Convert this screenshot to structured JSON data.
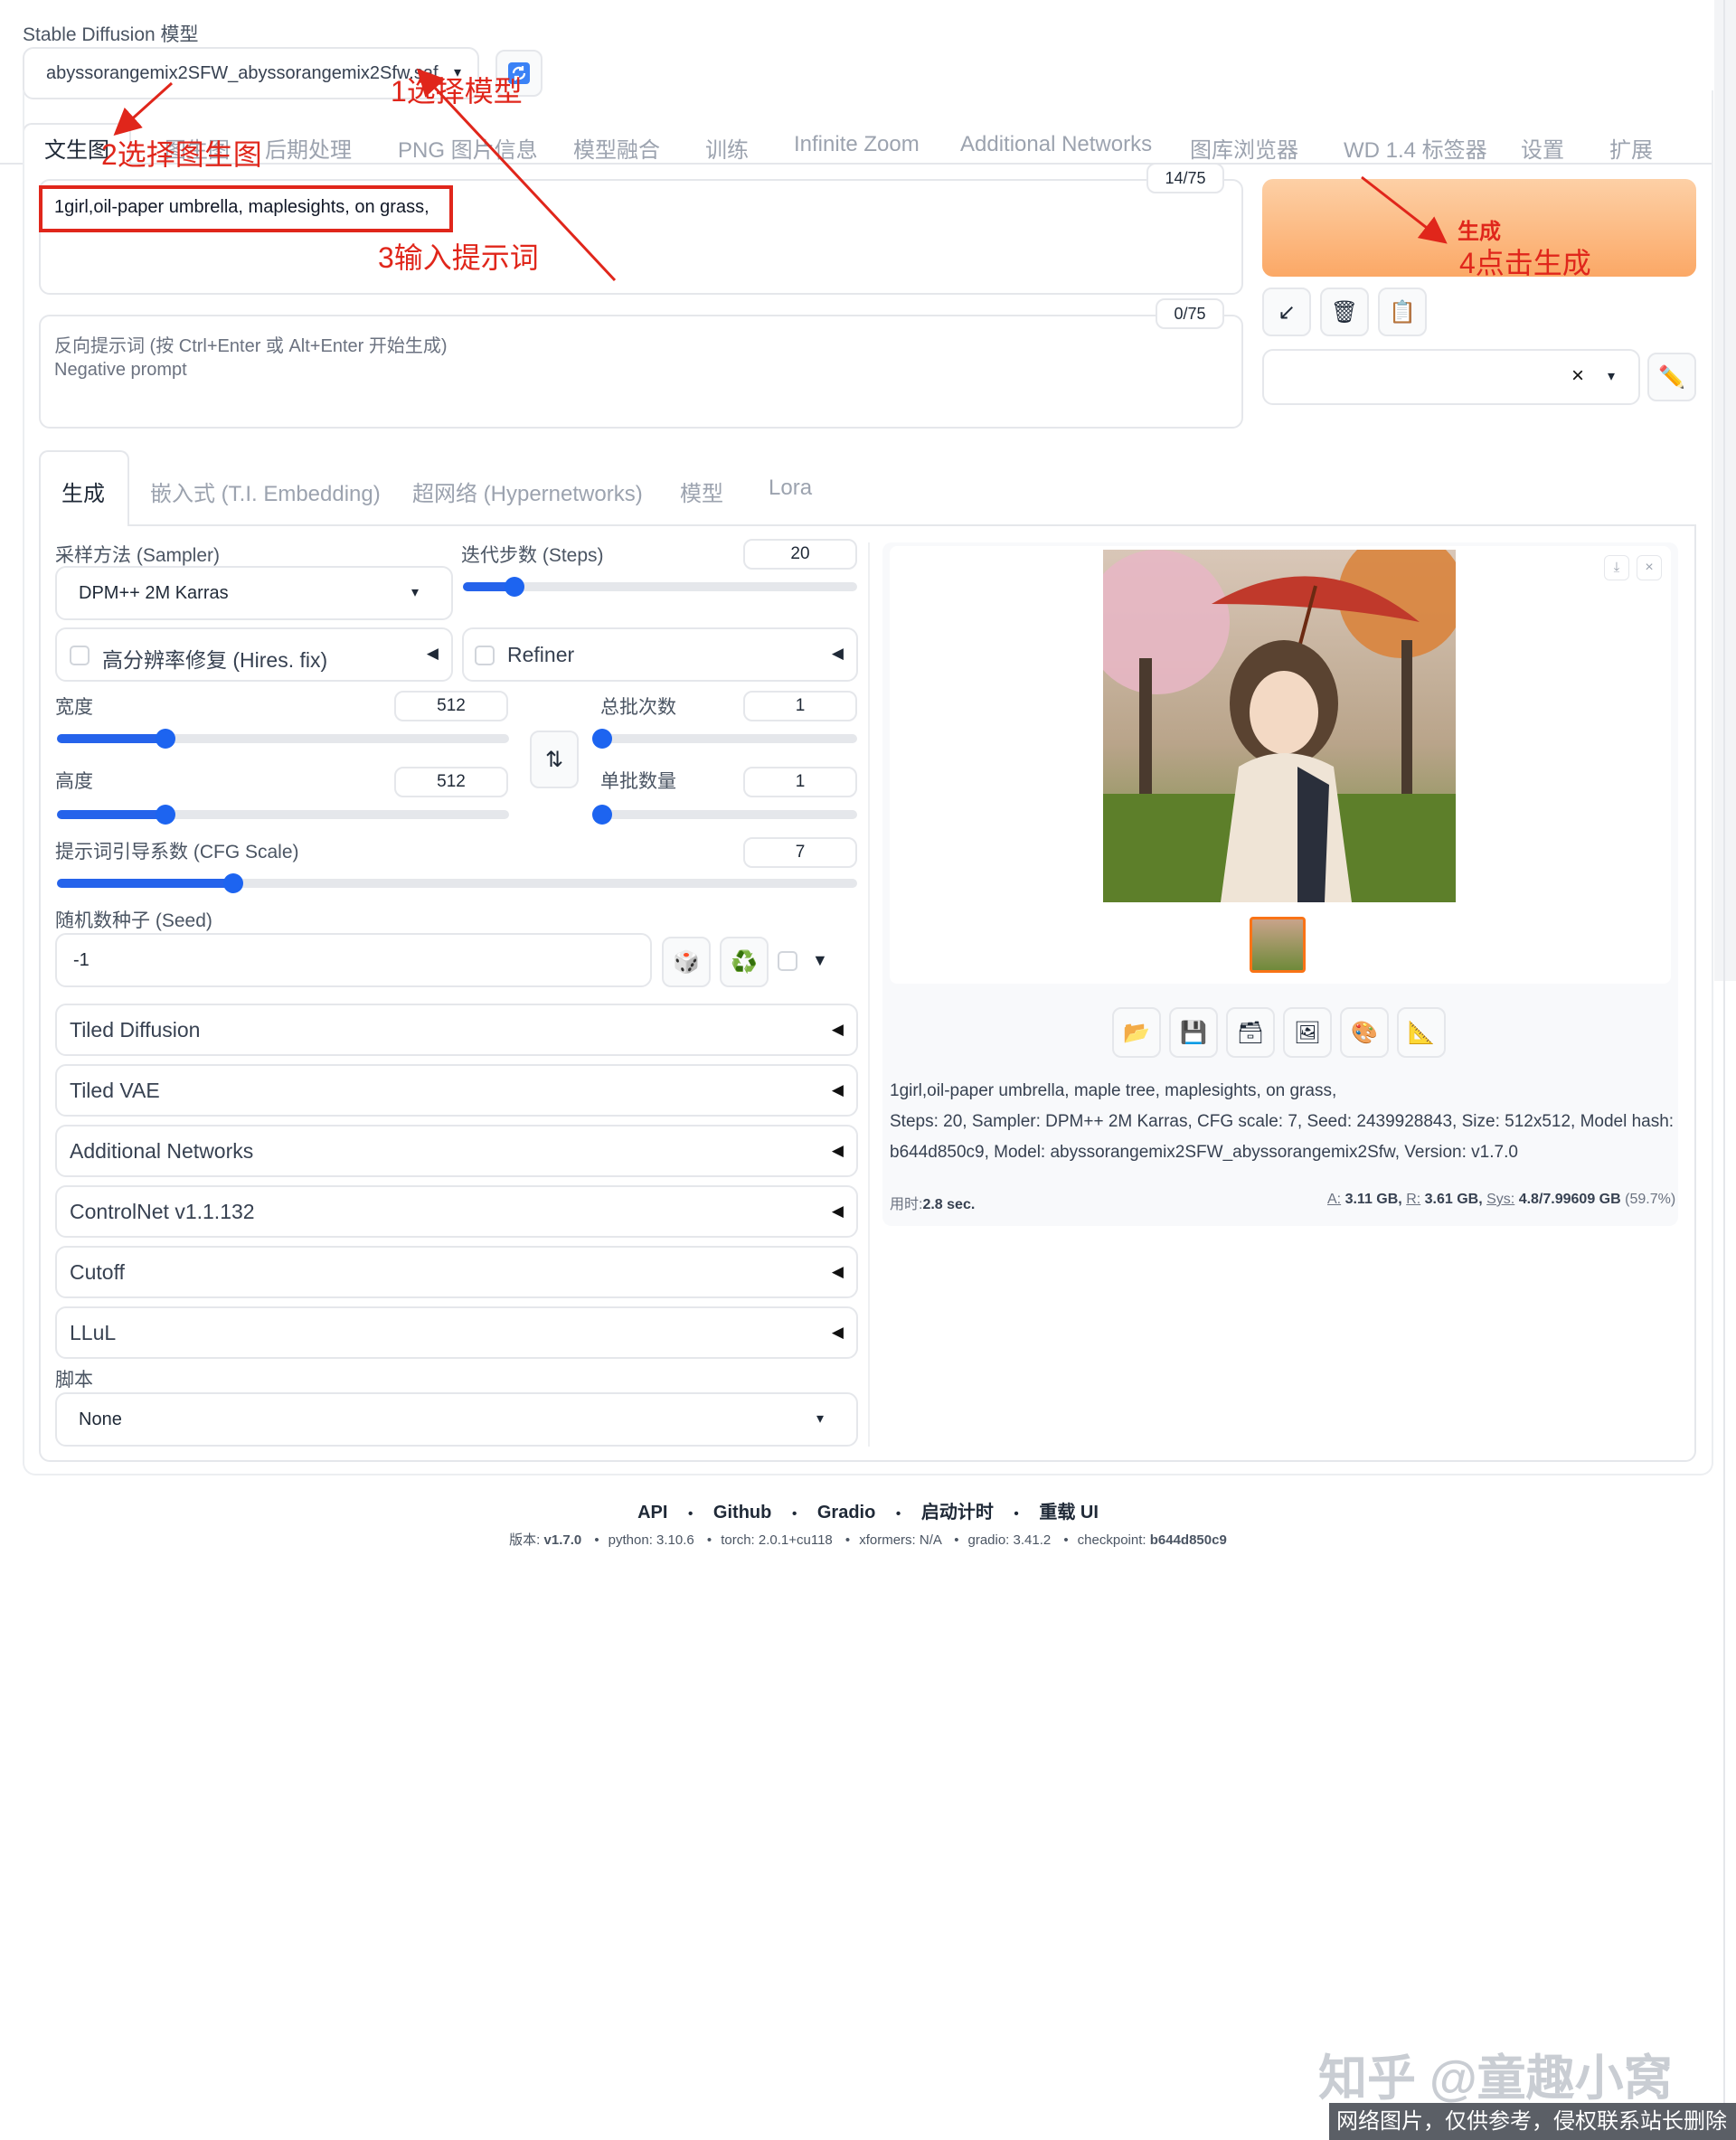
{
  "model": {
    "label": "Stable Diffusion 模型",
    "selected": "abyssorangemix2SFW_abyssorangemix2Sfw.saf"
  },
  "top_tabs": [
    "文生图",
    "图生图",
    "后期处理",
    "PNG 图片信息",
    "模型融合",
    "训练",
    "Infinite Zoom",
    "Additional Networks",
    "图库浏览器",
    "WD 1.4 标签器",
    "设置",
    "扩展"
  ],
  "prompt": {
    "value": "1girl,oil-paper umbrella, maplesights, on grass,",
    "counter": "14/75"
  },
  "negative_prompt": {
    "placeholder_line1": "反向提示词 (按 Ctrl+Enter 或 Alt+Enter 开始生成)",
    "placeholder_line2": "Negative prompt",
    "counter": "0/75"
  },
  "generate_button": "生成",
  "style_clear": "×",
  "sub_tabs": [
    "生成",
    "嵌入式 (T.I. Embedding)",
    "超网络 (Hypernetworks)",
    "模型",
    "Lora"
  ],
  "sampler": {
    "label": "采样方法 (Sampler)",
    "value": "DPM++ 2M Karras"
  },
  "steps": {
    "label": "迭代步数 (Steps)",
    "value": "20",
    "fraction": 0.13
  },
  "hires_fix": {
    "label": "高分辨率修复 (Hires. fix)"
  },
  "refiner": {
    "label": "Refiner"
  },
  "width": {
    "label": "宽度",
    "value": "512",
    "fraction": 0.24
  },
  "height": {
    "label": "高度",
    "value": "512",
    "fraction": 0.24
  },
  "batch_count": {
    "label": "总批次数",
    "value": "1",
    "fraction": 0.0
  },
  "batch_size": {
    "label": "单批数量",
    "value": "1",
    "fraction": 0.0
  },
  "cfg": {
    "label": "提示词引导系数 (CFG Scale)",
    "value": "7",
    "fraction": 0.22
  },
  "seed": {
    "label": "随机数种子 (Seed)",
    "value": "-1"
  },
  "accordions": [
    "Tiled Diffusion",
    "Tiled VAE",
    "Additional Networks",
    "ControlNet v1.1.132",
    "Cutoff",
    "LLuL"
  ],
  "script": {
    "label": "脚本",
    "value": "None"
  },
  "output": {
    "info_line1": "1girl,oil-paper umbrella, maple tree, maplesights, on grass,",
    "info_line2": "Steps: 20, Sampler: DPM++ 2M Karras, CFG scale: 7, Seed: 2439928843, Size: 512x512, Model hash:",
    "info_line3": "b644d850c9, Model: abyssorangemix2SFW_abyssorangemix2Sfw, Version: v1.7.0",
    "time_label": "用时:",
    "time_value": "2.8 sec.",
    "mem_a_label": "A:",
    "mem_a": "3.11 GB,",
    "mem_r_label": "R:",
    "mem_r": "3.61 GB,",
    "mem_sys_label": "Sys:",
    "mem_sys": "4.8/7.99609 GB",
    "mem_pct": "(59.7%)"
  },
  "footer": {
    "links": [
      "API",
      "Github",
      "Gradio",
      "启动计时",
      "重载 UI"
    ],
    "version_label": "版本:",
    "version": "v1.7.0",
    "python": "python: 3.10.6",
    "torch": "torch: 2.0.1+cu118",
    "xformers": "xformers: N/A",
    "gradio": "gradio: 3.41.2",
    "checkpoint_label": "checkpoint:",
    "checkpoint": "b644d850c9"
  },
  "annotations": {
    "a1": "1选择模型",
    "a2": "2选择图生图",
    "a3": "3输入提示词",
    "a4": "4点击生成",
    "a4_small": "生成"
  },
  "watermark": {
    "line1": "知乎 @童趣小窝",
    "line2": "网络图片，仅供参考，侵权联系站长删除"
  },
  "colors": {
    "accent_blue": "#2563eb",
    "generate_orange": "#fbb57a",
    "annotation_red": "#e0261b"
  }
}
